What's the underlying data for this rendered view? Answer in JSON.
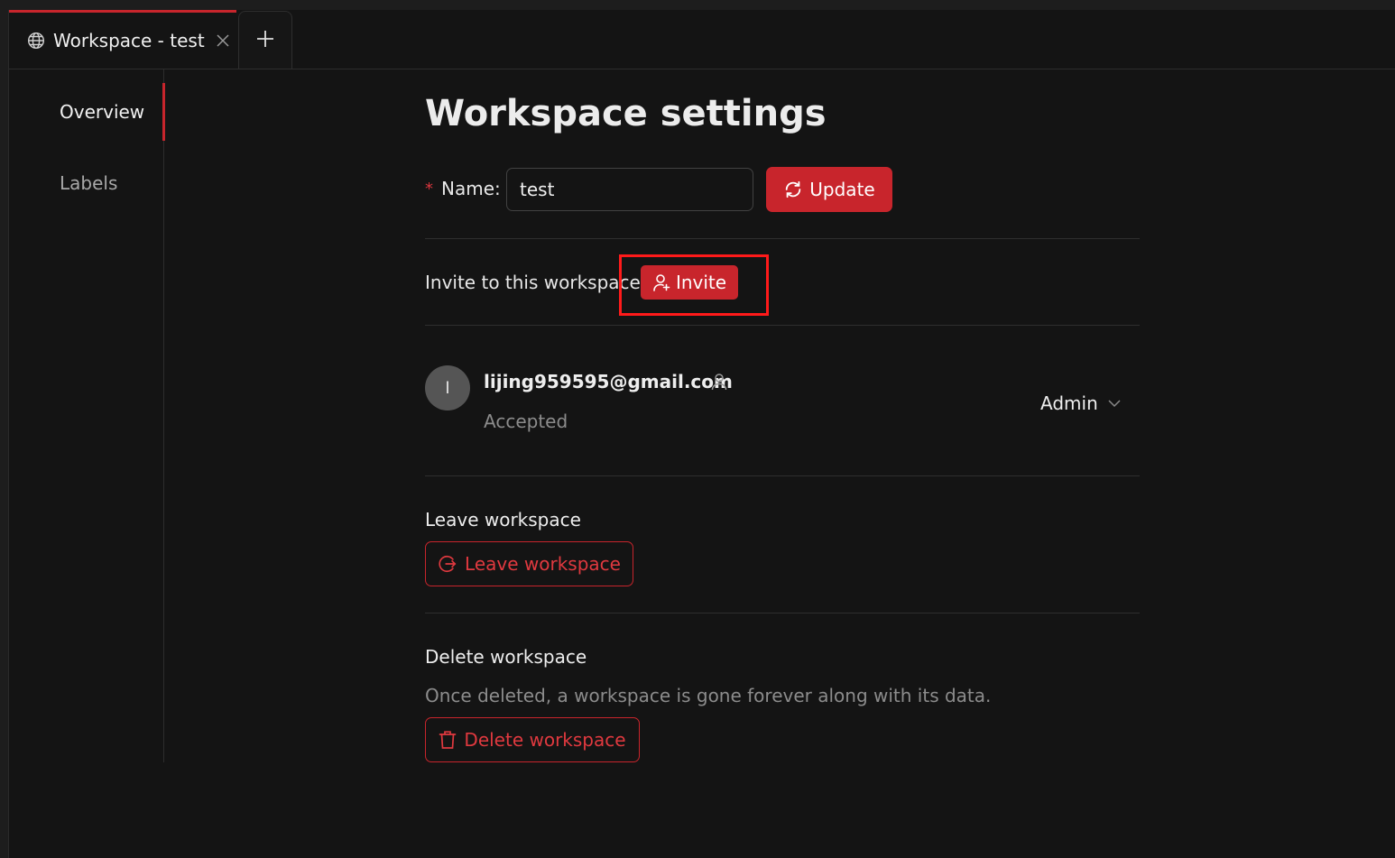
{
  "tabs": [
    {
      "label": "Workspace - test",
      "icon": "globe-icon",
      "active": true
    }
  ],
  "add_tab_icon": "plus-icon",
  "sidebar": {
    "items": [
      {
        "label": "Overview",
        "active": true
      },
      {
        "label": "Labels",
        "active": false
      }
    ]
  },
  "main": {
    "title": "Workspace settings",
    "name_field": {
      "required_marker": "*",
      "label": "Name",
      "value": "test"
    },
    "update_button": {
      "label": "Update",
      "icon": "refresh-icon"
    },
    "invite": {
      "text": "Invite to this workspace",
      "button_label": "Invite",
      "icon": "user-add-icon"
    },
    "members": [
      {
        "avatar_initial": "l",
        "email": "lijing959595@gmail.com",
        "status": "Accepted",
        "role": "Admin"
      }
    ],
    "leave": {
      "title": "Leave workspace",
      "button_label": "Leave workspace",
      "icon": "logout-icon"
    },
    "delete": {
      "title": "Delete workspace",
      "description": "Once deleted, a workspace is gone forever along with its data.",
      "button_label": "Delete workspace",
      "icon": "trash-icon"
    }
  },
  "colors": {
    "accent": "#c8252c",
    "background": "#141414",
    "annotation_box": "#ff1a1a"
  }
}
